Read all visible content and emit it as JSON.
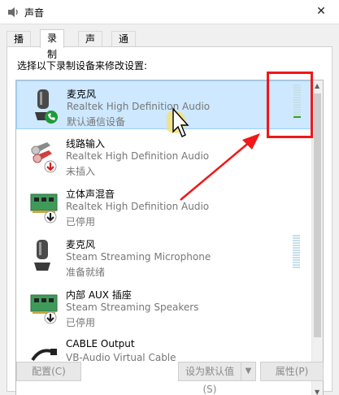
{
  "window": {
    "title": "声音",
    "close_glyph": "✕"
  },
  "tabs": [
    {
      "label": "播放",
      "active": false
    },
    {
      "label": "录制",
      "active": true
    },
    {
      "label": "声音",
      "active": false
    },
    {
      "label": "通信",
      "active": false
    }
  ],
  "instruction": "选择以下录制设备来修改设置:",
  "devices": [
    {
      "name": "麦克风",
      "description": "Realtek High Definition Audio",
      "status": "默认通信设备",
      "icon": "microphone-icon",
      "badge": "phone-badge-icon",
      "selected": true
    },
    {
      "name": "线路输入",
      "description": "Realtek High Definition Audio",
      "status": "未插入",
      "icon": "line-in-jack-icon",
      "badge": "unplugged-badge-icon",
      "selected": false
    },
    {
      "name": "立体声混音",
      "description": "Realtek High Definition Audio",
      "status": "已停用",
      "icon": "sound-card-icon",
      "badge": "disabled-badge-icon",
      "selected": false
    },
    {
      "name": "麦克风",
      "description": "Steam Streaming Microphone",
      "status": "准备就绪",
      "icon": "microphone-icon",
      "badge": "",
      "selected": false
    },
    {
      "name": "内部 AUX 插座",
      "description": "Steam Streaming Speakers",
      "status": "已停用",
      "icon": "sound-card-icon",
      "badge": "disabled-badge-icon",
      "selected": false
    },
    {
      "name": "CABLE Output",
      "description": "VB-Audio Virtual Cable",
      "status": "",
      "icon": "cable-icon",
      "badge": "",
      "selected": false
    }
  ],
  "buttons": {
    "configure": "配置(C)",
    "set_default": "设为默认值(S)",
    "properties": "属性(P)"
  },
  "colors": {
    "selection_bg": "#cde8ff",
    "meter_active": "#2aa52a",
    "highlight": "#f01818"
  }
}
